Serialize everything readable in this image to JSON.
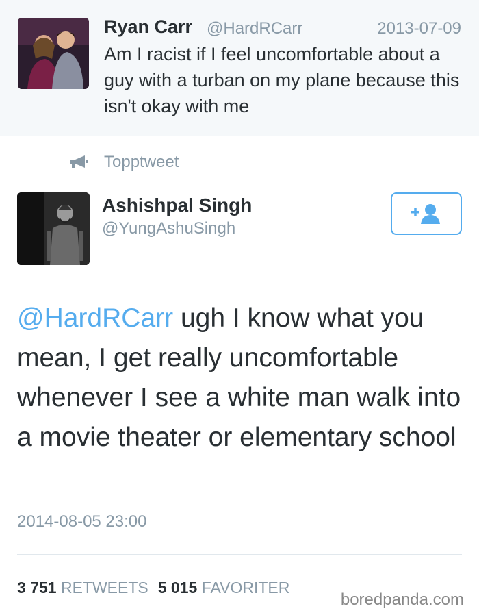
{
  "quoted_tweet": {
    "name": "Ryan Carr",
    "handle": "@HardRCarr",
    "date": "2013-07-09",
    "text": "Am I racist if I feel uncomfortable about a guy with a turban on my plane because this isn't okay with me"
  },
  "promoted": {
    "label": "Topptweet",
    "icon": "megaphone-icon"
  },
  "main_tweet": {
    "name": "Ashishpal Singh",
    "handle": "@YungAshuSingh",
    "follow_icon": "add-user-icon",
    "mention": "@HardRCarr",
    "text": " ugh I know what you mean, I get really uncomfortable whenever I see a white man walk into a movie theater or elementary school",
    "timestamp": "2014-08-05 23:00",
    "retweets_count": "3 751",
    "retweets_label": "RETWEETS",
    "favorites_count": "5 015",
    "favorites_label": "FAVORITER"
  },
  "watermark": "boredpanda.com",
  "colors": {
    "accent": "#55acee",
    "text": "#292f33",
    "muted": "#8899a6"
  }
}
